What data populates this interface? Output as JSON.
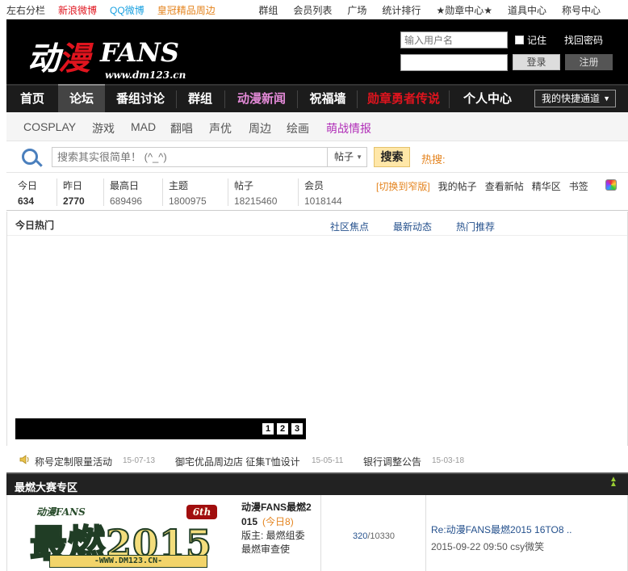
{
  "topbar": {
    "left_links": [
      {
        "label": "左右分栏",
        "color": "#333333"
      },
      {
        "label": "新浪微博",
        "color": "#e0141e"
      },
      {
        "label": "QQ微博",
        "color": "#1aa1e1"
      },
      {
        "label": "皇冠精品周边",
        "color": "#e4831d"
      }
    ],
    "right_links": [
      "群组",
      "会员列表",
      "广场",
      "统计排行",
      "★勋章中心★",
      "道具中心",
      "称号中心"
    ]
  },
  "logo": {
    "cn_first": "动",
    "cn_second": "漫",
    "en": "FANS",
    "url": "www.dm123.cn"
  },
  "login": {
    "username_placeholder": "输入用户名",
    "password_value": "",
    "remember_label": "记住",
    "find_password": "找回密码",
    "login_button": "登录",
    "register_button": "注册"
  },
  "mainnav": {
    "items": [
      {
        "label": "首页",
        "color": "#ffffff"
      },
      {
        "label": "论坛",
        "color": "#ffffff"
      },
      {
        "label": "番组讨论",
        "color": "#ffffff"
      },
      {
        "label": "群组",
        "color": "#ffffff"
      },
      {
        "label": "动漫新闻",
        "color": "#e58bd9"
      },
      {
        "label": "祝福墙",
        "color": "#ffffff"
      },
      {
        "label": "勋章勇者传说",
        "color": "#e0141e"
      },
      {
        "label": "个人中心",
        "color": "#ffffff"
      }
    ],
    "quick": "我的快捷通道"
  },
  "subnav": {
    "items": [
      {
        "label": "COSPLAY",
        "color": "#555555"
      },
      {
        "label": "游戏",
        "color": "#555555"
      },
      {
        "label": "MAD",
        "color": "#555555"
      },
      {
        "label": "翻唱",
        "color": "#555555"
      },
      {
        "label": "声优",
        "color": "#555555"
      },
      {
        "label": "周边",
        "color": "#555555"
      },
      {
        "label": "绘画",
        "color": "#555555"
      },
      {
        "label": "萌战情报",
        "color": "#b12fb8"
      }
    ]
  },
  "search": {
    "placeholder": "搜索其实很简单！ (^_^)",
    "type": "帖子",
    "button": "搜索",
    "hot_label": "热搜:"
  },
  "stats": {
    "items": [
      {
        "label": "今日",
        "value": "634"
      },
      {
        "label": "昨日",
        "value": "2770"
      },
      {
        "label": "最高日",
        "value": "689496"
      },
      {
        "label": "主题",
        "value": "1800975"
      },
      {
        "label": "帖子",
        "value": "18215460"
      },
      {
        "label": "会员",
        "value": "1018144"
      }
    ],
    "links": [
      "[切换到窄版]",
      "我的帖子",
      "查看新帖",
      "精华区",
      "书签"
    ]
  },
  "today_hot": {
    "title": "今日热门",
    "tabs": [
      "社区焦点",
      "最新动态",
      "热门推荐"
    ],
    "slides": [
      "1",
      "2",
      "3"
    ]
  },
  "announcements": [
    {
      "title": "称号定制限量活动",
      "date": "15-07-13"
    },
    {
      "title": "御宅优品周边店 征集T恤设计",
      "date": "15-05-11"
    },
    {
      "title": "银行调整公告",
      "date": "15-03-18"
    }
  ],
  "section": {
    "title": "最燃大赛专区",
    "forum": {
      "badge_top": "动漫FANS",
      "badge_edition": "6th",
      "badge_title": "最燃2015",
      "badge_url": "-WWW.DM123.CN-",
      "name_line1": "动漫FANS最燃2",
      "name_line2": "015",
      "today": "(今日8)",
      "moderator_line1": "版主: 最燃组委",
      "moderator_line2": "最燃审查使",
      "topics": "320",
      "posts": "/10330",
      "last_title": "Re:动漫FANS最燃2015 16TO8 ..",
      "last_time": "2015-09-22 09:50 csy微笑"
    }
  }
}
